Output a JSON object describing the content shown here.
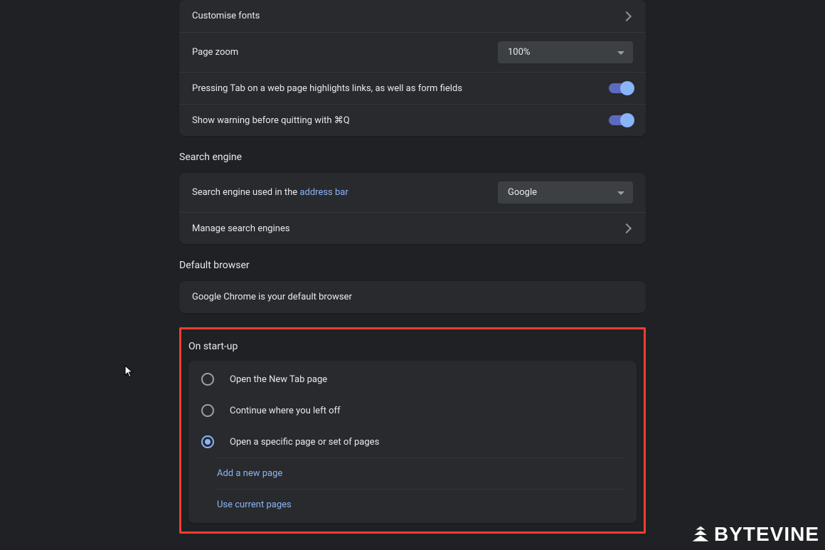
{
  "appearance": {
    "customise_fonts": "Customise fonts",
    "page_zoom_label": "Page zoom",
    "page_zoom_value": "100%",
    "tab_highlight_label": "Pressing Tab on a web page highlights links, as well as form fields",
    "quit_warning_label": "Show warning before quitting with ⌘Q"
  },
  "search_engine": {
    "title": "Search engine",
    "used_label_prefix": "Search engine used in the ",
    "used_label_link": "address bar",
    "selected": "Google",
    "manage_label": "Manage search engines"
  },
  "default_browser": {
    "title": "Default browser",
    "message": "Google Chrome is your default browser"
  },
  "startup": {
    "title": "On start-up",
    "options": {
      "new_tab": "Open the New Tab page",
      "continue": "Continue where you left off",
      "specific": "Open a specific page or set of pages"
    },
    "add_page": "Add a new page",
    "use_current": "Use current pages"
  },
  "watermark": "BYTEVINE"
}
